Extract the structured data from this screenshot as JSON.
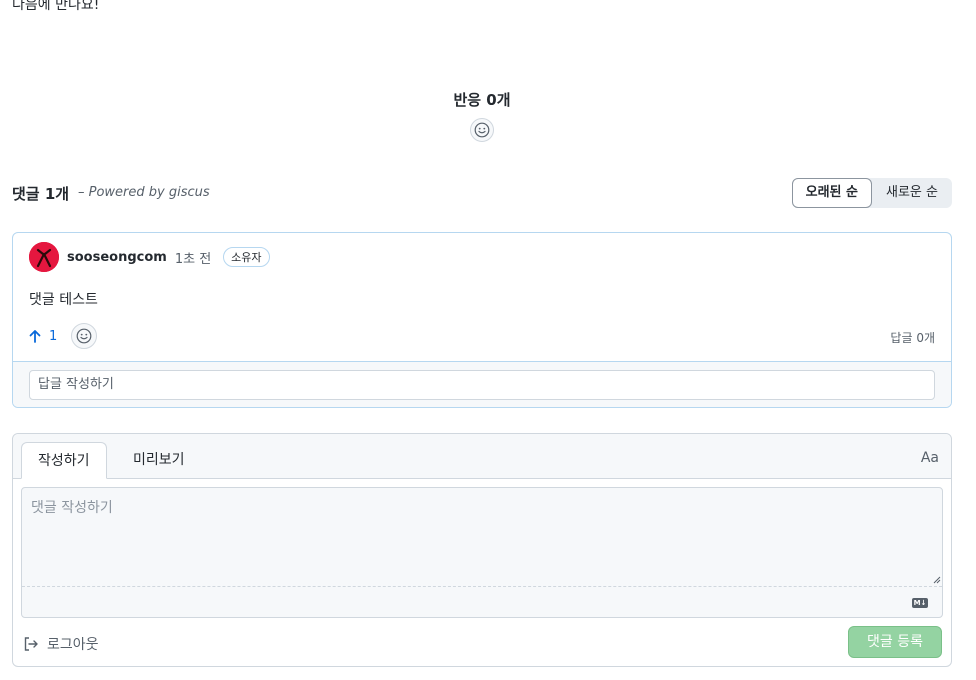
{
  "intro_text": "다음에 만나요!",
  "reactions": {
    "title": "반응 0개"
  },
  "comments_header": {
    "count_label": "댓글 1개",
    "powered_by": "– Powered by giscus",
    "sort_options": [
      "오래된 순",
      "새로운 순"
    ],
    "sort_selected": "오래된 순"
  },
  "comment": {
    "author": "sooseongcom",
    "time": "1초 전",
    "badge": "소유자",
    "body": "댓글 테스트",
    "upvotes": "1",
    "reply_count": "답글 0개",
    "reply_placeholder": "답글 작성하기",
    "avatar_color": "#e5173f"
  },
  "editor": {
    "tabs": [
      "작성하기",
      "미리보기"
    ],
    "active_tab": "작성하기",
    "font_toggle": "Aa",
    "placeholder": "댓글 작성하기",
    "markdown_badge": "M↓",
    "logout_label": "로그아웃",
    "submit_label": "댓글 등록",
    "submit_color": "#94d3a2"
  }
}
